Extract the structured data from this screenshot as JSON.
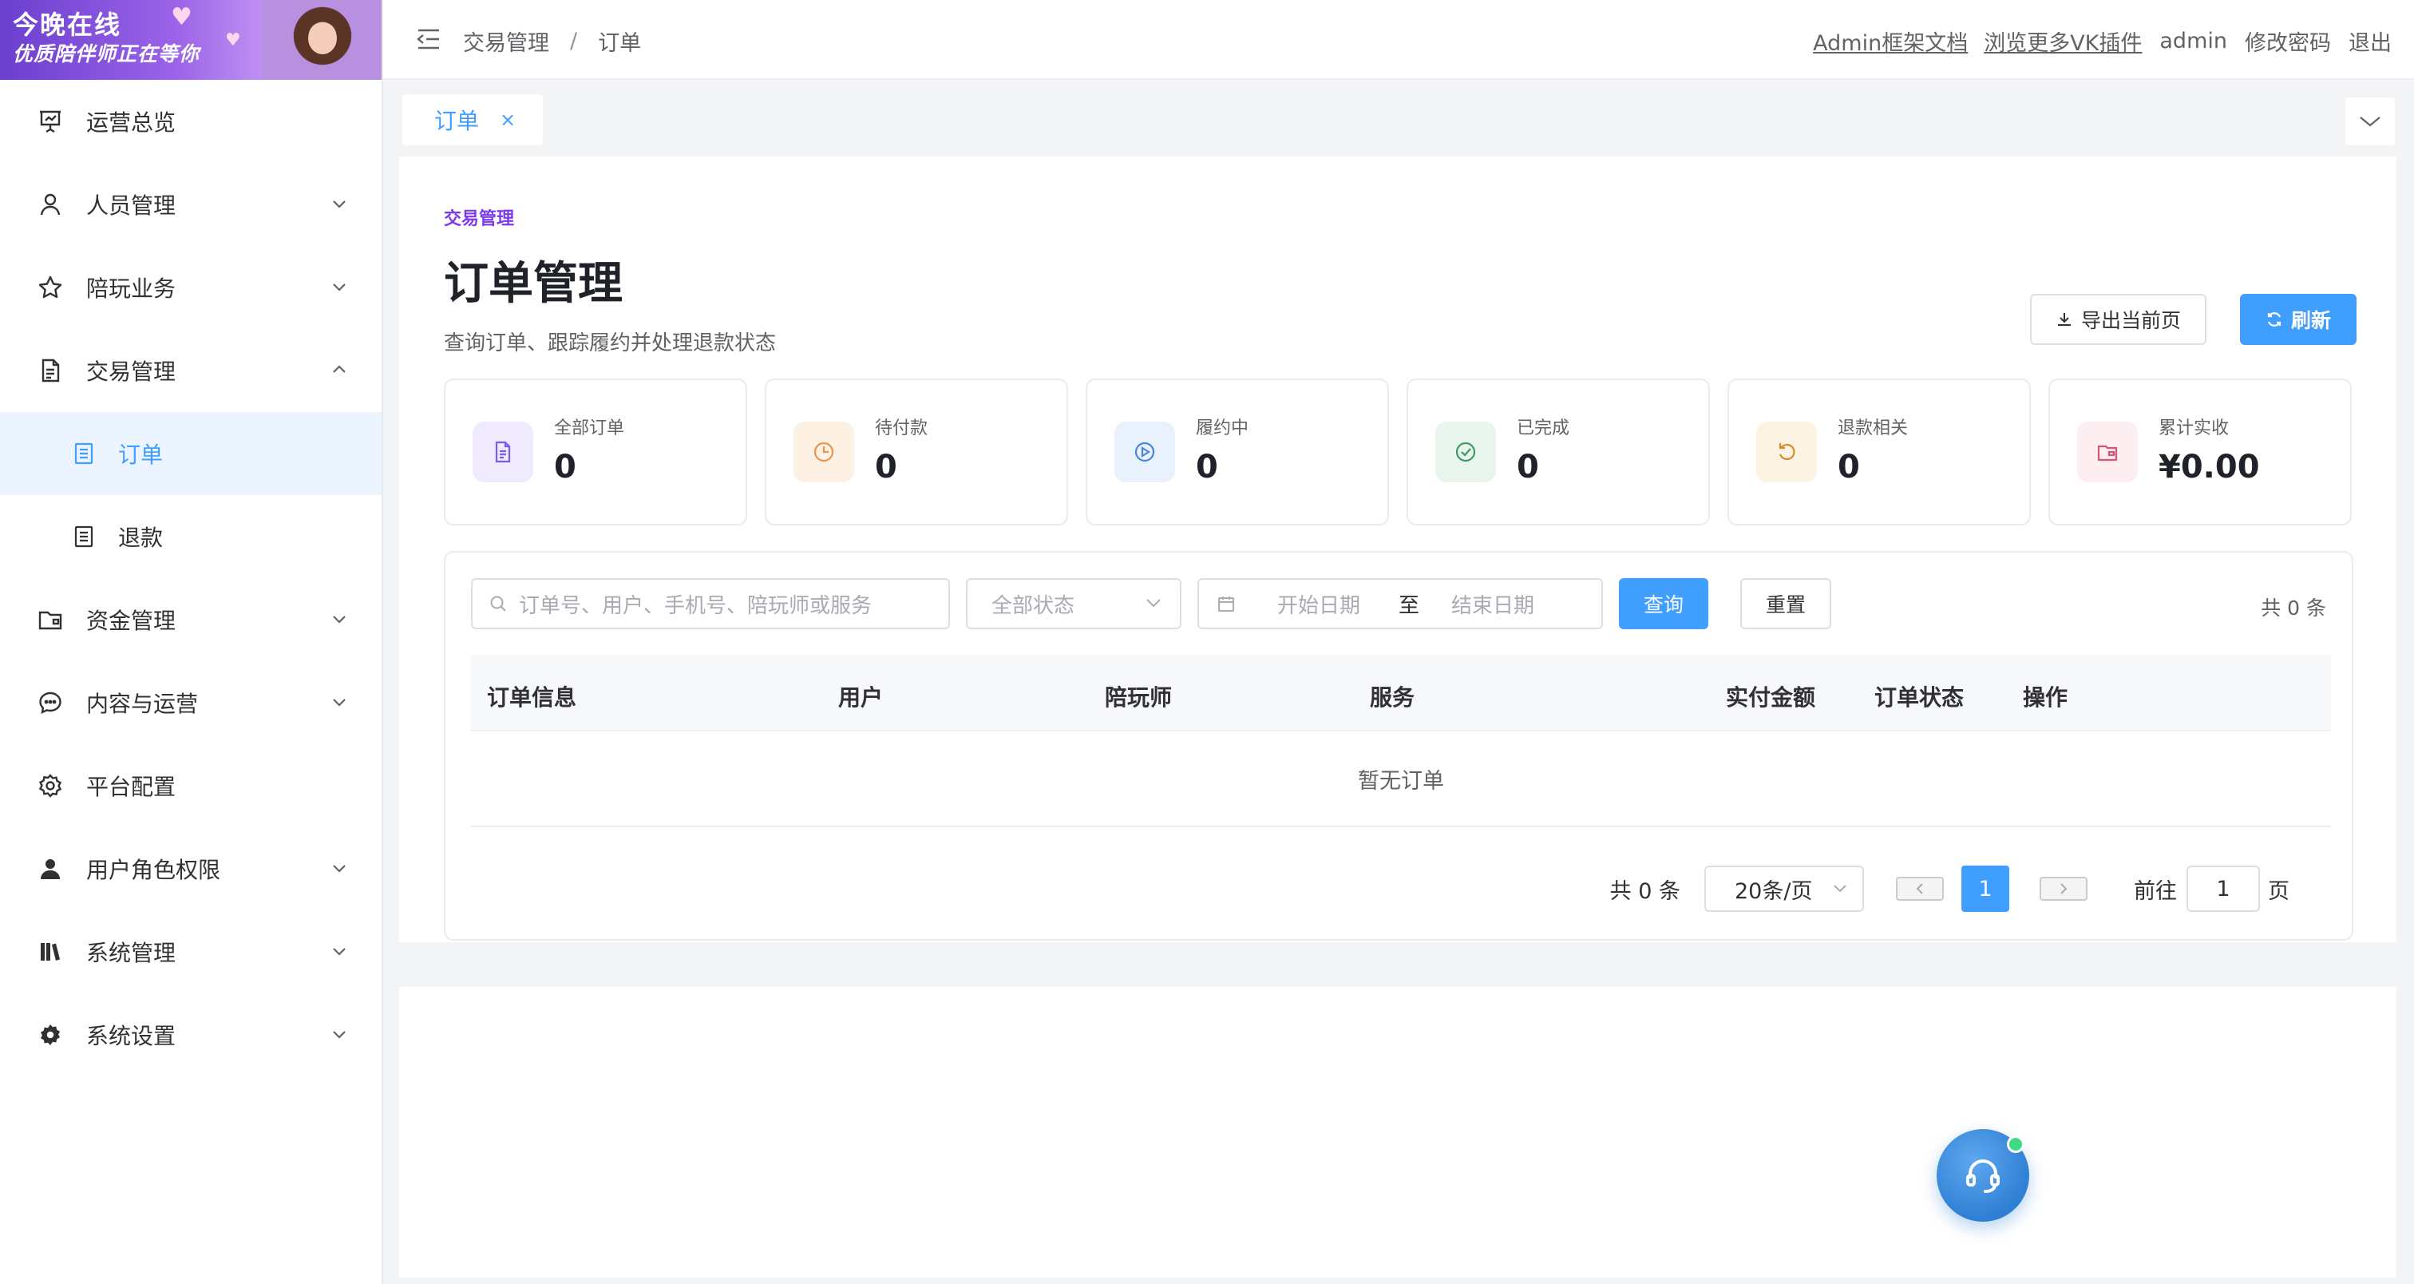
{
  "brand": {
    "line1": "今晚在线",
    "line2": "优质陪伴师正在等你"
  },
  "sidebar": {
    "items": [
      {
        "label": "运营总览",
        "icon": "presentation-icon",
        "expandable": false
      },
      {
        "label": "人员管理",
        "icon": "user-icon",
        "expandable": true
      },
      {
        "label": "陪玩业务",
        "icon": "star-icon",
        "expandable": true
      },
      {
        "label": "交易管理",
        "icon": "document-icon",
        "expandable": true,
        "expanded": true,
        "children": [
          {
            "label": "订单",
            "icon": "list-icon",
            "active": true
          },
          {
            "label": "退款",
            "icon": "list-icon"
          }
        ]
      },
      {
        "label": "资金管理",
        "icon": "folder-icon",
        "expandable": true
      },
      {
        "label": "内容与运营",
        "icon": "chat-icon",
        "expandable": true
      },
      {
        "label": "平台配置",
        "icon": "gear-icon",
        "expandable": false
      },
      {
        "label": "用户角色权限",
        "icon": "person-solid-icon",
        "expandable": true
      },
      {
        "label": "系统管理",
        "icon": "library-icon",
        "expandable": true
      },
      {
        "label": "系统设置",
        "icon": "cog-solid-icon",
        "expandable": true
      }
    ]
  },
  "topbar": {
    "breadcrumb": [
      "交易管理",
      "订单"
    ],
    "separator": "/",
    "links": [
      "Admin框架文档",
      "浏览更多VK插件"
    ],
    "user": "admin",
    "change_password": "修改密码",
    "logout": "退出"
  },
  "tabs": [
    {
      "label": "订单",
      "close": "×"
    }
  ],
  "page": {
    "eyebrow": "交易管理",
    "title": "订单管理",
    "subtitle": "查询订单、跟踪履约并处理退款状态",
    "export_label": "导出当前页",
    "refresh_label": "刷新"
  },
  "stats": [
    {
      "label": "全部订单",
      "value": "0",
      "icon": "document-icon",
      "bg": "#efeafd",
      "fg": "#7c5ce6"
    },
    {
      "label": "待付款",
      "value": "0",
      "icon": "clock-icon",
      "bg": "#fdf1e3",
      "fg": "#e8944a"
    },
    {
      "label": "履约中",
      "value": "0",
      "icon": "play-circle-icon",
      "bg": "#e9f1fd",
      "fg": "#4a86d8"
    },
    {
      "label": "已完成",
      "value": "0",
      "icon": "check-circle-icon",
      "bg": "#e7f5ec",
      "fg": "#3d9a62"
    },
    {
      "label": "退款相关",
      "value": "0",
      "icon": "refresh-icon",
      "bg": "#fdf3e2",
      "fg": "#d88a2a"
    },
    {
      "label": "累计实收",
      "value": "¥0.00",
      "icon": "wallet-icon",
      "bg": "#fdeef1",
      "fg": "#d05576"
    }
  ],
  "filters": {
    "search_placeholder": "订单号、用户、手机号、陪玩师或服务",
    "status_placeholder": "全部状态",
    "start_placeholder": "开始日期",
    "range_sep": "至",
    "end_placeholder": "结束日期",
    "query_label": "查询",
    "reset_label": "重置",
    "total_text": "共 0 条"
  },
  "table": {
    "columns": [
      "订单信息",
      "用户",
      "陪玩师",
      "服务",
      "实付金额",
      "订单状态",
      "操作"
    ],
    "empty_text": "暂无订单"
  },
  "pagination": {
    "total_text": "共 0 条",
    "page_size": "20条/页",
    "current_page": "1",
    "goto_label": "前往",
    "goto_value": "1",
    "page_suffix": "页"
  },
  "colors": {
    "primary": "#409eff",
    "eyebrow": "#7c3aed",
    "online_dot": "#3ddc84"
  }
}
